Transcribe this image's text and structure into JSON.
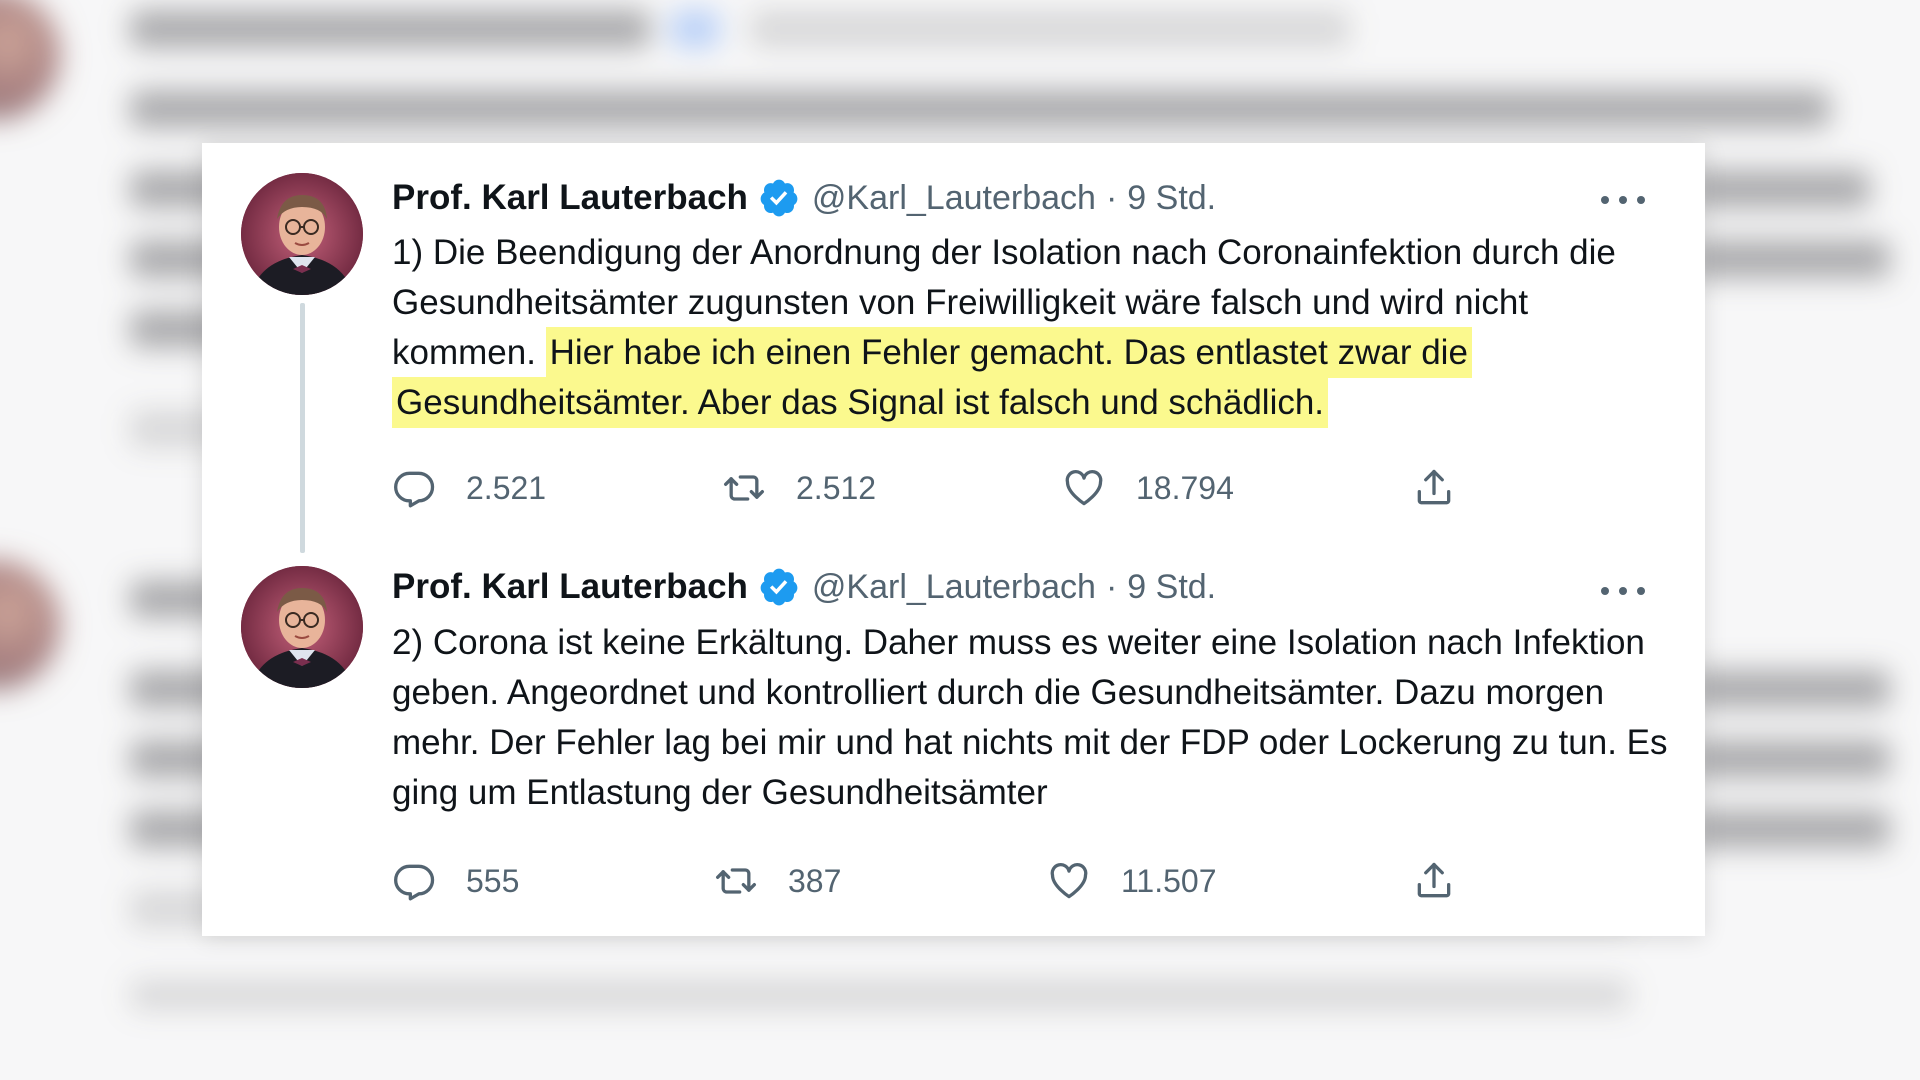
{
  "tweets": [
    {
      "author": "Prof. Karl Lauterbach",
      "handle": "@Karl_Lauterbach",
      "separator": "·",
      "time": "9 Std.",
      "text_plain": "1) Die Beendigung der Anordnung der Isolation nach Coronainfektion durch die Gesundheitsämter zugunsten von Freiwilligkeit wäre falsch und wird nicht kommen. ",
      "text_highlight": "Hier habe ich einen Fehler gemacht. Das entlastet zwar die Gesundheitsämter. Aber das Signal ist falsch und schädlich.",
      "replies": "2.521",
      "retweets": "2.512",
      "likes": "18.794"
    },
    {
      "author": "Prof. Karl Lauterbach",
      "handle": "@Karl_Lauterbach",
      "separator": "·",
      "time": "9 Std.",
      "text_plain": "2) Corona ist keine Erkältung. Daher muss es weiter eine Isolation nach Infektion geben. Angeordnet und kontrolliert durch die Gesundheitsämter. Dazu morgen mehr. Der Fehler lag bei mir und hat nichts mit der FDP oder Lockerung zu tun. Es ging um Entlastung der Gesundheitsämter",
      "text_highlight": "",
      "replies": "555",
      "retweets": "387",
      "likes": "11.507"
    }
  ],
  "colors": {
    "text_primary": "#0f1419",
    "text_secondary": "#536471",
    "verified_blue": "#1d9bf0",
    "highlight_yellow": "#fbf98e"
  },
  "icons": [
    "reply-icon",
    "retweet-icon",
    "like-icon",
    "share-icon",
    "verified-badge-icon",
    "more-options-icon"
  ]
}
